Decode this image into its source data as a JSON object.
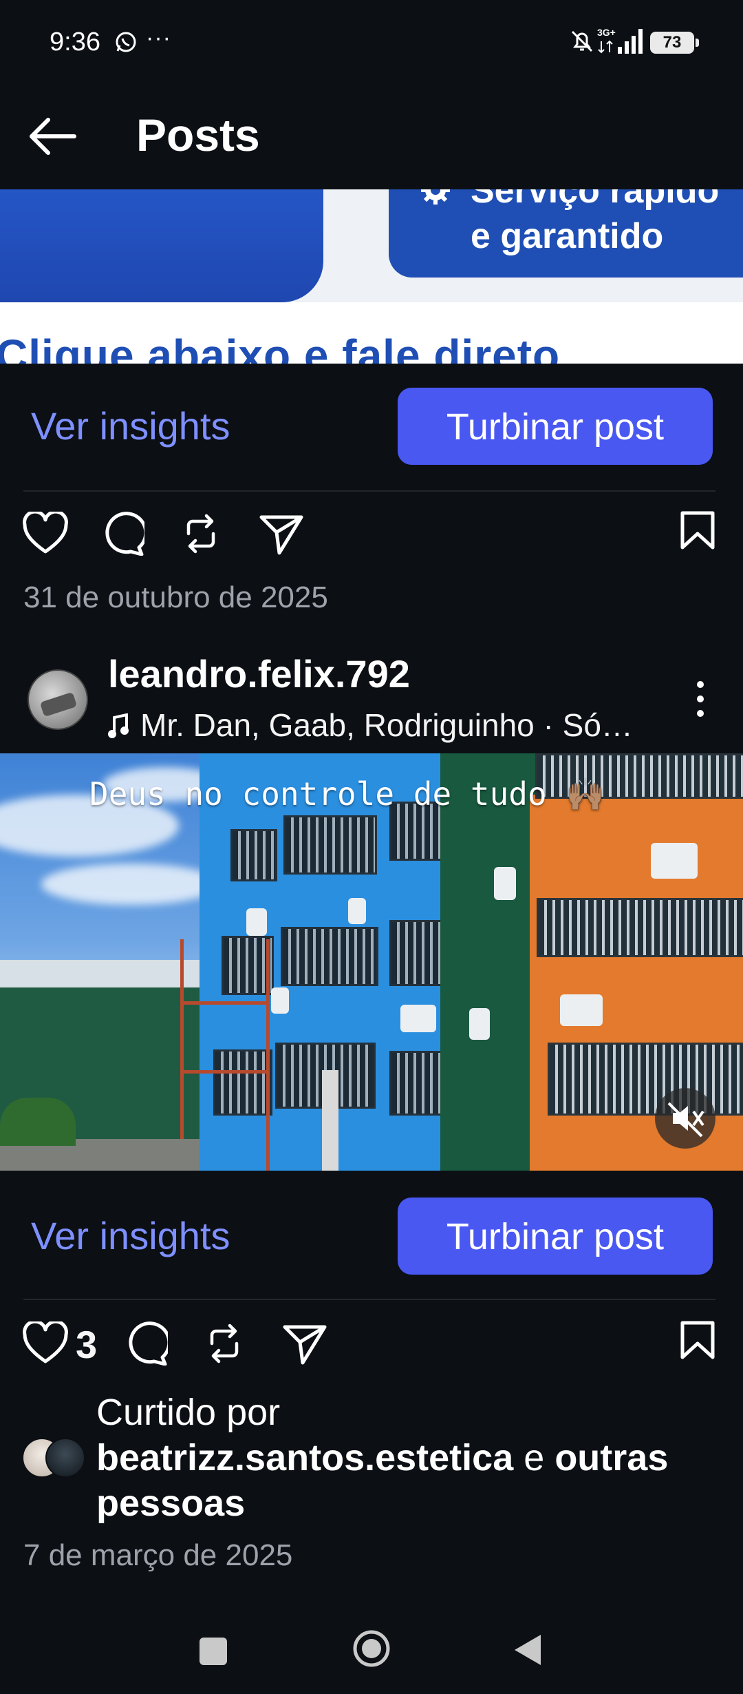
{
  "status_bar": {
    "time": "9:36",
    "overflow": "···",
    "network": "3G+",
    "battery": "73",
    "icons": [
      "whatsapp-icon",
      "bell-off-icon",
      "signal-icon"
    ]
  },
  "header": {
    "back_icon": "arrow-left-icon",
    "title": "Posts"
  },
  "ad_banner": {
    "line1": "Serviço rápido",
    "line2": "e garantido",
    "cta": "Clique abaixo e fale direto"
  },
  "post1": {
    "insights_label": "Ver insights",
    "boost_label": "Turbinar post",
    "date": "31 de outubro de 2025"
  },
  "post2": {
    "username": "leandro.felix.792",
    "music": "Mr. Dan, Gaab, Rodriguinho · Só…",
    "caption_overlay": "Deus no controle de tudo",
    "caption_emoji": "🙌🏽",
    "insights_label": "Ver insights",
    "boost_label": "Turbinar post",
    "likes_count": "3",
    "liked_prefix": "Curtido por",
    "liked_user": "beatrizz.santos.estetica",
    "liked_mid": "e",
    "liked_rest_a": "outras",
    "liked_rest_b": "pessoas",
    "date": "7 de março de 2025"
  },
  "colors": {
    "background": "#0c0f14",
    "accent_link": "#7e90ff",
    "boost_button": "#4a58f2",
    "muted_text": "#9ea3ab"
  }
}
